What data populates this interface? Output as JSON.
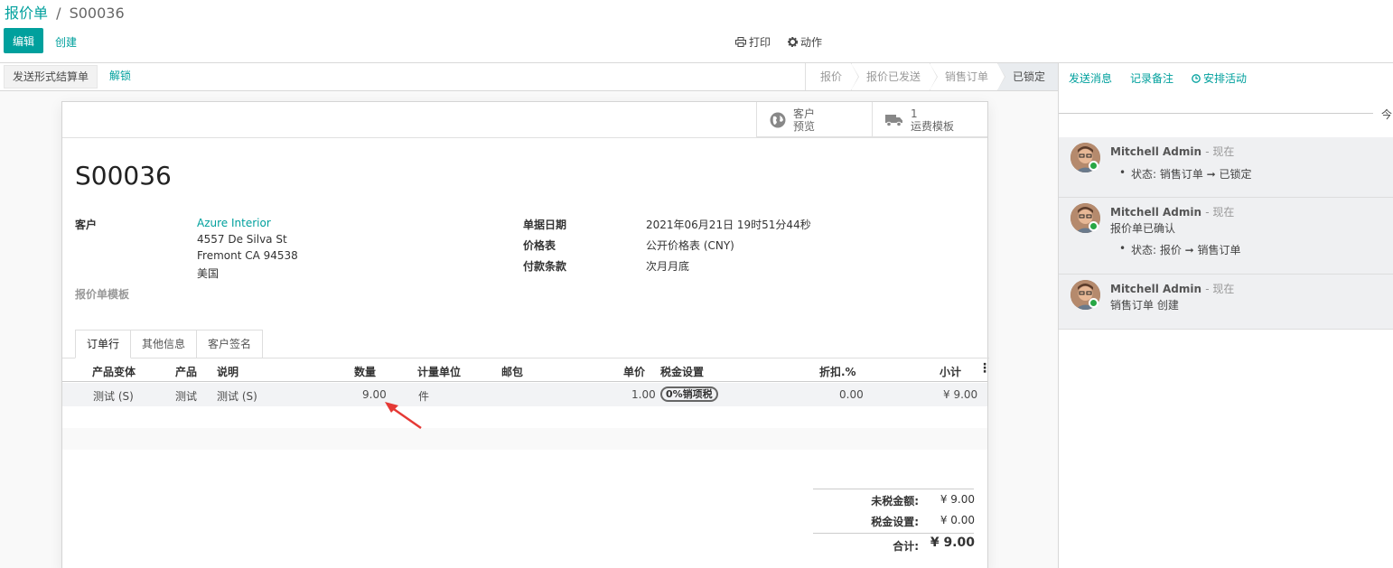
{
  "breadcrumb": {
    "parent": "报价单",
    "separator": "/",
    "current": "S00036"
  },
  "toolbar": {
    "edit": "编辑",
    "create": "创建",
    "print": "打印",
    "action": "动作"
  },
  "statusbar": {
    "buttons": [
      "发送形式结算单",
      "解锁"
    ],
    "steps": [
      "报价",
      "报价已发送",
      "销售订单",
      "已锁定"
    ],
    "active_step": "已锁定"
  },
  "smart_buttons": [
    {
      "icon": "globe-icon",
      "line1": "客户",
      "line2": "预览"
    },
    {
      "icon": "truck-icon",
      "line1": "1",
      "line2": "运费模板"
    }
  ],
  "record": {
    "name": "S00036",
    "customer_label": "客户",
    "customer_name": "Azure Interior",
    "address1": "4557 De Silva St",
    "address2": "Fremont CA 94538",
    "country": "美国",
    "template_label": "报价单模板",
    "date_label": "单据日期",
    "date_value": "2021年06月21日 19时51分44秒",
    "pricelist_label": "价格表",
    "pricelist_value": "公开价格表 (CNY)",
    "terms_label": "付款条款",
    "terms_value": "次月月底"
  },
  "tabs": [
    "订单行",
    "其他信息",
    "客户签名"
  ],
  "table": {
    "headers": [
      "产品变体",
      "产品",
      "说明",
      "数量",
      "计量单位",
      "邮包",
      "单价",
      "税金设置",
      "折扣.%",
      "小计"
    ],
    "rows": [
      {
        "variant": "测试 (S)",
        "product": "测试",
        "desc": "测试 (S)",
        "qty": "9.00",
        "uom": "件",
        "package": "",
        "price": "1.00",
        "tax": "0%销项税",
        "discount": "0.00",
        "subtotal": "¥ 9.00"
      }
    ]
  },
  "totals": {
    "untaxed_label": "未税金额:",
    "untaxed": "¥ 9.00",
    "tax_label": "税金设置:",
    "tax": "¥ 0.00",
    "total_label": "合计:",
    "total": "¥ 9.00"
  },
  "chatter": {
    "send_message": "发送消息",
    "log_note": "记录备注",
    "schedule": "安排活动",
    "today": "今",
    "messages": [
      {
        "author": "Mitchell Admin",
        "time": "- 现在",
        "body": "",
        "tracking": "状态: 销售订单 ➞ 已锁定"
      },
      {
        "author": "Mitchell Admin",
        "time": "- 现在",
        "body": "报价单已确认",
        "tracking": "状态: 报价 ➞ 销售订单"
      },
      {
        "author": "Mitchell Admin",
        "time": "- 现在",
        "body": "销售订单 创建",
        "tracking": ""
      }
    ]
  },
  "colors": {
    "primary": "#00A09D",
    "annotation_arrow": "#e53935"
  }
}
